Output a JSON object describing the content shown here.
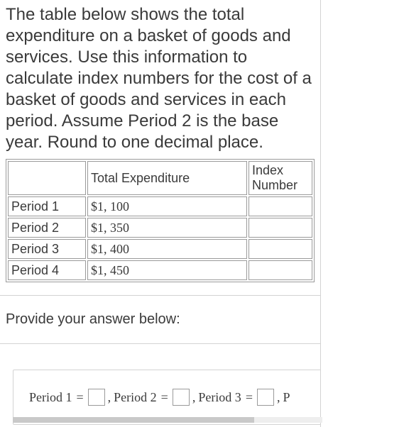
{
  "question": "The table below shows the total expenditure on a basket of goods and services. Use this information to calculate index numbers for the cost of a basket of goods and services in each period. Assume Period 2 is the base year. Round to one decimal place.",
  "table": {
    "headers": {
      "period": "",
      "expenditure": "Total Expenditure",
      "index": "Index Number"
    },
    "rows": [
      {
        "period": "Period 1",
        "expenditure": "$1, 100",
        "index": ""
      },
      {
        "period": "Period 2",
        "expenditure": "$1, 350",
        "index": ""
      },
      {
        "period": "Period 3",
        "expenditure": "$1, 400",
        "index": ""
      },
      {
        "period": "Period 4",
        "expenditure": "$1, 450",
        "index": ""
      }
    ]
  },
  "prompt_label": "Provide your answer below:",
  "answer_line": {
    "p1_label": "Period 1",
    "p2_label": "Period 2",
    "p3_label": "Period 3",
    "p4_label_truncated": "P",
    "equals": "=",
    "comma": ","
  }
}
